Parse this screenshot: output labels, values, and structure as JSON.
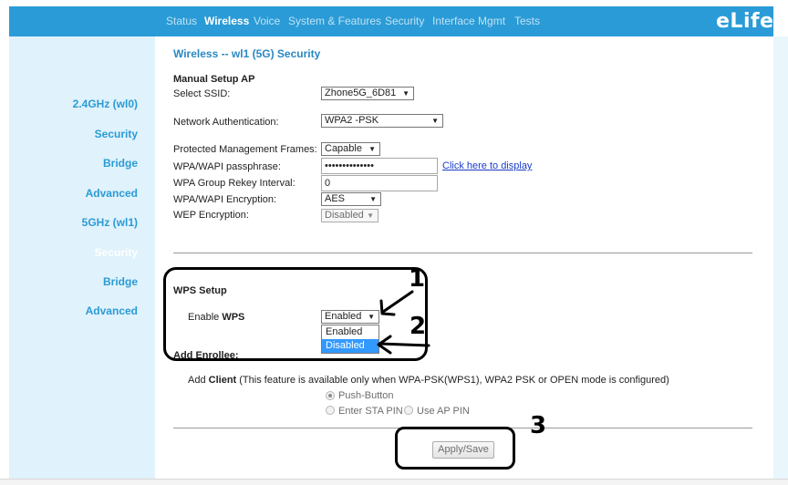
{
  "header": {
    "nav": [
      "Status",
      "Wireless",
      "Voice",
      "System & Features",
      "Security",
      "Interface Mgmt",
      "Tests"
    ],
    "active_nav": "Wireless",
    "logo": "eLife"
  },
  "sidebar": {
    "items": [
      "2.4GHz (wl0)",
      "Security",
      "Bridge",
      "Advanced",
      "5GHz (wl1)",
      "Security",
      "Bridge",
      "Advanced"
    ],
    "current": "Security (5GHz)"
  },
  "main": {
    "page_title": "Wireless -- wl1 (5G) Security",
    "section_title": "Manual Setup AP",
    "select_ssid": {
      "label": "Select SSID:",
      "value": "Zhone5G_6D81"
    },
    "network_auth": {
      "label": "Network Authentication:",
      "value": "WPA2 -PSK"
    },
    "pmf": {
      "label": "Protected Management Frames:",
      "value": "Capable"
    },
    "passphrase": {
      "label": "WPA/WAPI passphrase:",
      "value": "••••••••••••••",
      "link": "Click here to display"
    },
    "rekey": {
      "label": "WPA Group Rekey Interval:",
      "value": "0"
    },
    "encryption": {
      "label": "WPA/WAPI Encryption:",
      "value": "AES"
    },
    "wep": {
      "label": "WEP Encryption:",
      "value": "Disabled"
    }
  },
  "wps": {
    "title": "WPS Setup",
    "enable_label_prefix": "Enable ",
    "enable_label_bold": "WPS",
    "selected": "Enabled",
    "options": [
      "Enabled",
      "Disabled"
    ],
    "highlighted_option": "Disabled",
    "add_enrollee": "Add Enrollee:",
    "client_prefix": "Add ",
    "client_bold": "Client",
    "client_note": " (This feature is available only when WPA-PSK(WPS1), WPA2 PSK or OPEN mode is configured)",
    "radios": [
      "Push-Button",
      "Enter STA PIN",
      "Use AP PIN"
    ],
    "checked_radio": "Push-Button"
  },
  "apply_label": "Apply/Save",
  "annotations": [
    "1",
    "2",
    "3"
  ],
  "colors": {
    "brand": "#2a9bd6",
    "sidebar_bg": "#e0f2fb",
    "highlight": "#3399ff"
  },
  "icons": {
    "dropdown": "triangle-down",
    "annotation_arrow": "hand-drawn-arrow"
  }
}
